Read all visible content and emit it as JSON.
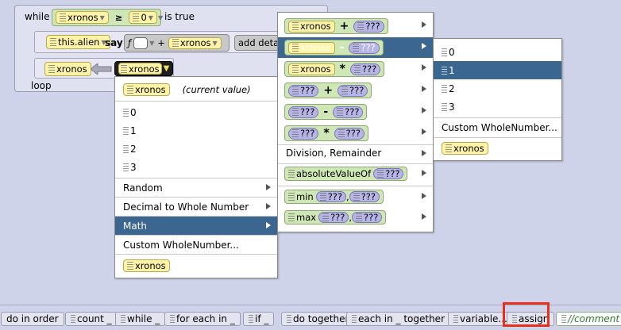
{
  "editor": {
    "while_kw": "while",
    "while_var": "xronos",
    "compare_op": "≥",
    "compare_val": "0",
    "is_true": "is true",
    "this_alien": "this.alien",
    "say": "say",
    "plus": "+",
    "say_var": "xronos",
    "add_detail": "add detai",
    "assign_var": "xronos",
    "assign_value": "xronos",
    "loop": "loop"
  },
  "menu1": {
    "current_var": "xronos",
    "current_value": "(current value)",
    "n0": "0",
    "n1": "1",
    "n2": "2",
    "n3": "3",
    "random": "Random",
    "decimal": "Decimal to Whole Number",
    "math": "Math",
    "custom": "Custom WholeNumber...",
    "var_bottom": "xronos"
  },
  "menu2": {
    "items": [
      {
        "left": "xronos",
        "op": "+",
        "right": "???"
      },
      {
        "left": "xronos",
        "op": "-",
        "right": "???"
      },
      {
        "left": "xronos",
        "op": "*",
        "right": "???"
      },
      {
        "left": "???",
        "op": "+",
        "right": "???"
      },
      {
        "left": "???",
        "op": "-",
        "right": "???"
      },
      {
        "left": "???",
        "op": "*",
        "right": "???"
      }
    ],
    "division": "Division, Remainder",
    "abs_fn": "absoluteValueOf",
    "abs_arg": "???",
    "min_fn": "min",
    "max_fn": "max",
    "arg": "???",
    "comma": ","
  },
  "menu3": {
    "n0": "0",
    "n1": "1",
    "n2": "2",
    "n3": "3",
    "custom": "Custom WholeNumber...",
    "var": "xronos"
  },
  "bottom": {
    "items": [
      "do in order",
      "count _",
      "while _",
      "for each in _",
      "if _",
      "do together",
      "each in _ together",
      "variable...",
      "assign",
      "//comment"
    ]
  }
}
